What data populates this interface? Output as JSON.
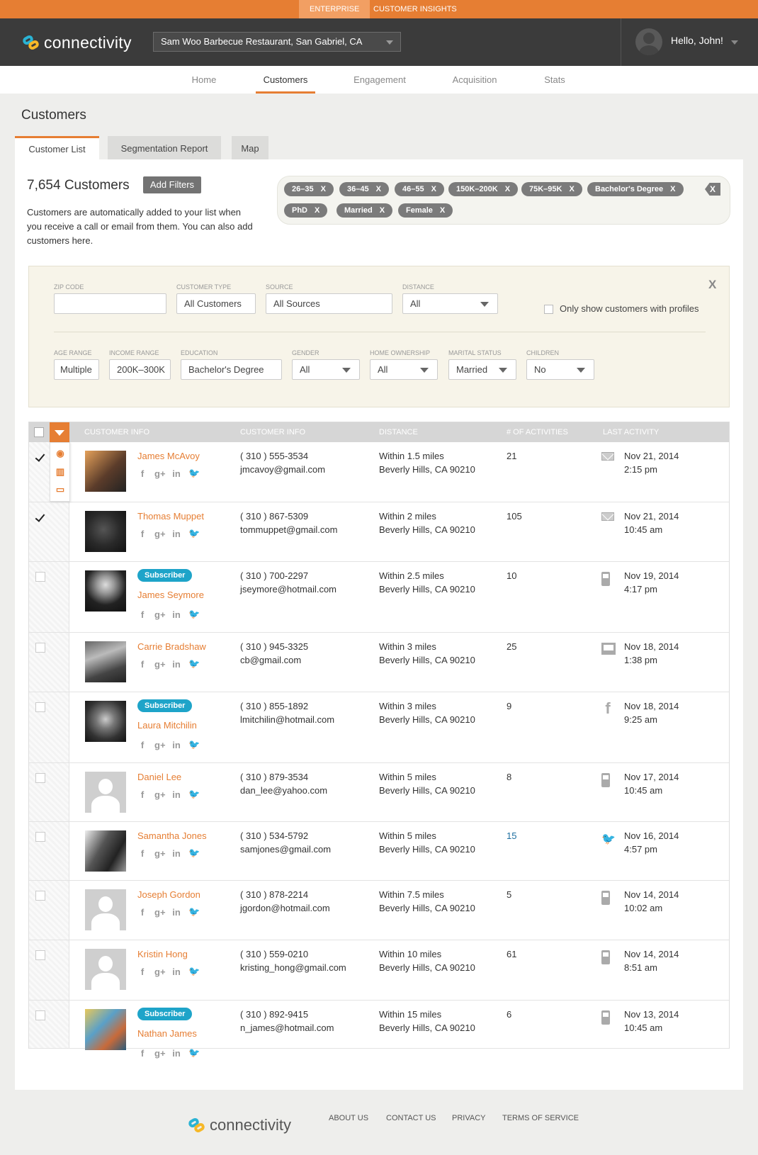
{
  "topbar": {
    "enterprise": "ENTERPRISE",
    "customer_insights": "CUSTOMER INSIGHTS"
  },
  "brand": {
    "name": "connectivity",
    "accent": "#e67e33",
    "teal": "#1ea4c9"
  },
  "location_select": {
    "value": "Sam Woo Barbecue Restaurant, San Gabriel, CA"
  },
  "user": {
    "greeting": "Hello, John!"
  },
  "nav": {
    "items": [
      "Home",
      "Customers",
      "Engagement",
      "Acquisition",
      "Stats"
    ],
    "active": "Customers"
  },
  "page": {
    "title": "Customers"
  },
  "tabs": [
    "Customer List",
    "Segmentation Report",
    "Map"
  ],
  "summary": {
    "count": "7,654 Customers",
    "add_filters": "Add Filters",
    "description": "Customers are automatically added to your list when you receive a call or email from them. You can also add customers here."
  },
  "active_filters": [
    "26–35",
    "36–45",
    "46–55",
    "150K–200K",
    "75K–95K",
    "Bachelor's Degree",
    "PhD",
    "Married",
    "Female"
  ],
  "chip_x": "X",
  "filters": {
    "zip": {
      "label": "ZIP CODE",
      "value": ""
    },
    "customer_type": {
      "label": "CUSTOMER TYPE",
      "value": "All Customers"
    },
    "source": {
      "label": "SOURCE",
      "value": "All Sources"
    },
    "distance": {
      "label": "DISTANCE",
      "value": "All"
    },
    "profiles_only": {
      "label": "Only show customers with profiles"
    },
    "age": {
      "label": "AGE RANGE",
      "value": "Multiple"
    },
    "income": {
      "label": "INCOME RANGE",
      "value": "200K–300K"
    },
    "education": {
      "label": "EDUCATION",
      "value": "Bachelor's Degree"
    },
    "gender": {
      "label": "GENDER",
      "value": "All"
    },
    "home": {
      "label": "HOME OWNERSHIP",
      "value": "All"
    },
    "marital": {
      "label": "MARITAL STATUS",
      "value": "Married"
    },
    "children": {
      "label": "CHILDREN",
      "value": "No"
    },
    "close": "X"
  },
  "table": {
    "headers": [
      "CUSTOMER INFO",
      "CUSTOMER INFO",
      "DISTANCE",
      "# OF ACTIVITIES",
      "LAST ACTIVITY"
    ],
    "subscriber_label": "Subscriber",
    "rows": [
      {
        "name": "James McAvoy",
        "phone": "( 310 ) 555-3534",
        "email": "jmcavoy@gmail.com",
        "distance": "Within 1.5 miles",
        "city": "Beverly Hills, CA 90210",
        "activities": "21",
        "date": "Nov 21, 2014",
        "time": "2:15 pm",
        "activity_icon": "mail-icon",
        "checked": true,
        "subscriber": false
      },
      {
        "name": "Thomas Muppet",
        "phone": "( 310 ) 867-5309",
        "email": "tommuppet@gmail.com",
        "distance": "Within 2 miles",
        "city": "Beverly Hills, CA 90210",
        "activities": "105",
        "date": "Nov 21, 2014",
        "time": "10:45 am",
        "activity_icon": "mail-icon",
        "checked": true,
        "subscriber": false
      },
      {
        "name": "James Seymore",
        "phone": "( 310 ) 700-2297",
        "email": "jseymore@hotmail.com",
        "distance": "Within 2.5 miles",
        "city": "Beverly Hills, CA 90210",
        "activities": "10",
        "date": "Nov 19, 2014",
        "time": "4:17 pm",
        "activity_icon": "phone-icon",
        "checked": false,
        "subscriber": true
      },
      {
        "name": "Carrie Bradshaw",
        "phone": "( 310 ) 945-3325",
        "email": "cb@gmail.com",
        "distance": "Within 3 miles",
        "city": "Beverly Hills, CA 90210",
        "activities": "25",
        "date": "Nov 18, 2014",
        "time": "1:38 pm",
        "activity_icon": "web-icon",
        "checked": false,
        "subscriber": false
      },
      {
        "name": "Laura Mitchilin",
        "phone": "( 310 ) 855-1892",
        "email": "lmitchilin@hotmail.com",
        "distance": "Within 3 miles",
        "city": "Beverly Hills, CA 90210",
        "activities": "9",
        "date": "Nov 18, 2014",
        "time": "9:25 am",
        "activity_icon": "facebook-icon",
        "checked": false,
        "subscriber": true
      },
      {
        "name": "Daniel Lee",
        "phone": "( 310 ) 879-3534",
        "email": "dan_lee@yahoo.com",
        "distance": "Within 5 miles",
        "city": "Beverly Hills, CA 90210",
        "activities": "8",
        "date": "Nov 17, 2014",
        "time": "10:45 am",
        "activity_icon": "phone-icon",
        "checked": false,
        "subscriber": false
      },
      {
        "name": "Samantha Jones",
        "phone": "( 310 ) 534-5792",
        "email": "samjones@gmail.com",
        "distance": "Within 5 miles",
        "city": "Beverly Hills, CA 90210",
        "activities": "15",
        "date": "Nov 16, 2014",
        "time": "4:57 pm",
        "activity_icon": "twitter-icon",
        "checked": false,
        "subscriber": false
      },
      {
        "name": "Joseph Gordon",
        "phone": "( 310 ) 878-2214",
        "email": "jgordon@hotmail.com",
        "distance": "Within 7.5 miles",
        "city": "Beverly Hills, CA 90210",
        "activities": "5",
        "date": "Nov 14, 2014",
        "time": "10:02 am",
        "activity_icon": "phone-icon",
        "checked": false,
        "subscriber": false
      },
      {
        "name": "Kristin Hong",
        "phone": "( 310 ) 559-0210",
        "email": "kristing_hong@gmail.com",
        "distance": "Within 10 miles",
        "city": "Beverly Hills, CA 90210",
        "activities": "61",
        "date": "Nov 14, 2014",
        "time": "8:51 am",
        "activity_icon": "phone-icon",
        "checked": false,
        "subscriber": false
      },
      {
        "name": "Nathan James",
        "phone": "( 310 ) 892-9415",
        "email": "n_james@hotmail.com",
        "distance": "Within 15 miles",
        "city": "Beverly Hills, CA 90210",
        "activities": "6",
        "date": "Nov 13, 2014",
        "time": "10:45 am",
        "activity_icon": "phone-icon",
        "checked": false,
        "subscriber": true
      }
    ]
  },
  "footer": {
    "links": [
      "ABOUT US",
      "CONTACT US",
      "PRIVACY",
      "TERMS OF SERVICE"
    ]
  }
}
